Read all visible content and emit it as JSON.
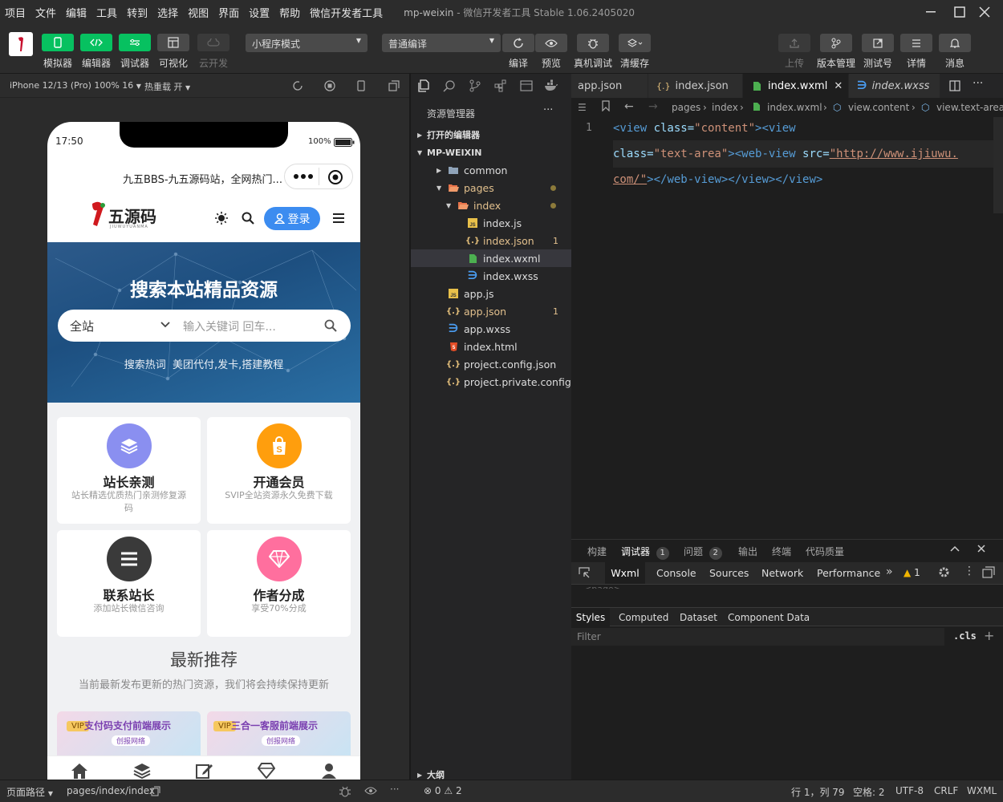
{
  "menu": {
    "items": [
      "项目",
      "文件",
      "编辑",
      "工具",
      "转到",
      "选择",
      "视图",
      "界面",
      "设置",
      "帮助",
      "微信开发者工具"
    ],
    "window_title_app": "mp-weixin",
    "window_title_rest": "- 微信开发者工具 Stable 1.06.2405020"
  },
  "toolbar": {
    "simulator": "模拟器",
    "editor": "编辑器",
    "debugger": "调试器",
    "visual": "可视化",
    "cloud": "云开发",
    "mode_select": "小程序模式",
    "compile_select": "普通编译",
    "compile": "编译",
    "preview": "预览",
    "real_debug": "真机调试",
    "clear_cache": "清缓存",
    "upload": "上传",
    "version": "版本管理",
    "test": "测试号",
    "details": "详情",
    "messages": "消息"
  },
  "simbar": {
    "device": "iPhone 12/13 (Pro) 100% 16",
    "hot_reload": "热重载 开"
  },
  "phone": {
    "time": "17:50",
    "battery": "100%",
    "nav_title": "九五BBS-九五源码站，全网热门...",
    "logo_text": "五源码",
    "logo_sub": "JIUWUYUANMA",
    "login": "登录",
    "banner_title": "搜索本站精品资源",
    "search_scope": "全站",
    "search_placeholder": "输入关键词 回车...",
    "hot_label": "搜索热词",
    "hot_words": "美团代付,发卡,搭建教程",
    "cards": [
      {
        "title": "站长亲测",
        "sub": "站长精选优质热门亲测修复源码",
        "color": "#8a8ff0",
        "icon": "layers-icon"
      },
      {
        "title": "开通会员",
        "sub": "SVIP全站资源永久免费下载",
        "color": "#ff9e0d",
        "icon": "bag-icon"
      },
      {
        "title": "联系站长",
        "sub": "添加站长微信咨询",
        "color": "#3a3a3a",
        "icon": "list-icon"
      },
      {
        "title": "作者分成",
        "sub": "享受70%分成",
        "color": "#ff6f9e",
        "icon": "diamond-icon"
      }
    ],
    "section_title": "最新推荐",
    "section_sub": "当前最新发布更新的热门资源，我们将会持续保持更新",
    "thumbs": [
      {
        "vip": "VIP",
        "text": "支付码支付前端展示",
        "sub": "创报网络"
      },
      {
        "vip": "VIP",
        "text": "三合一客服前端展示",
        "sub": "创报网络"
      }
    ]
  },
  "explorer": {
    "title": "资源管理器",
    "open_editors": "打开的编辑器",
    "project": "MP-WEIXIN",
    "items": [
      {
        "label": "common",
        "depth": 1,
        "type": "folder"
      },
      {
        "label": "pages",
        "depth": 1,
        "type": "folder-open"
      },
      {
        "label": "index",
        "depth": 2,
        "type": "folder-open"
      },
      {
        "label": "index.js",
        "depth": 3,
        "type": "js"
      },
      {
        "label": "index.json",
        "depth": 3,
        "type": "json",
        "badge": "1"
      },
      {
        "label": "index.wxml",
        "depth": 3,
        "type": "wxml"
      },
      {
        "label": "index.wxss",
        "depth": 3,
        "type": "wxss"
      },
      {
        "label": "app.js",
        "depth": 1,
        "type": "js"
      },
      {
        "label": "app.json",
        "depth": 1,
        "type": "json",
        "badge": "1"
      },
      {
        "label": "app.wxss",
        "depth": 1,
        "type": "wxss"
      },
      {
        "label": "index.html",
        "depth": 1,
        "type": "html"
      },
      {
        "label": "project.config.json",
        "depth": 1,
        "type": "json2"
      },
      {
        "label": "project.private.config.js...",
        "depth": 1,
        "type": "json2"
      }
    ],
    "outline": "大纲"
  },
  "editor": {
    "tabs": [
      "app.json",
      "index.json",
      "index.wxml",
      "index.wxss"
    ],
    "crumbs": [
      "pages",
      "index",
      "index.wxml",
      "view.content",
      "view.text-area"
    ],
    "line_no": "1",
    "code": {
      "l1_a": "<view ",
      "l1_attr": "class=",
      "l1_val": "\"content\"",
      "l1_b": "><view",
      "l2_attr": "class=",
      "l2_val": "\"text-area\"",
      "l2_b": "><web-view ",
      "l2_attr2": "src=",
      "l2_val2": "\"http://www.ijiuwu.",
      "l3_val": "com/\"",
      "l3_b": "></web-view></view></view>"
    }
  },
  "devtools": {
    "top_tabs": [
      "构建",
      "调试器",
      "问题",
      "输出",
      "终端",
      "代码质量"
    ],
    "debugger_badge": "1",
    "problems_badge": "2",
    "panels": [
      "Wxml",
      "Console",
      "Sources",
      "Network",
      "Performance"
    ],
    "warn_count": "1",
    "sub_tabs": [
      "Styles",
      "Computed",
      "Dataset",
      "Component Data"
    ],
    "filter_placeholder": "Filter",
    "cls": ".cls"
  },
  "status": {
    "path_label": "页面路径",
    "path": "pages/index/index",
    "errors": "0",
    "warnings": "2",
    "position": "行 1，列 79",
    "spaces": "空格: 2",
    "encoding": "UTF-8",
    "eol": "CRLF",
    "lang": "WXML"
  }
}
